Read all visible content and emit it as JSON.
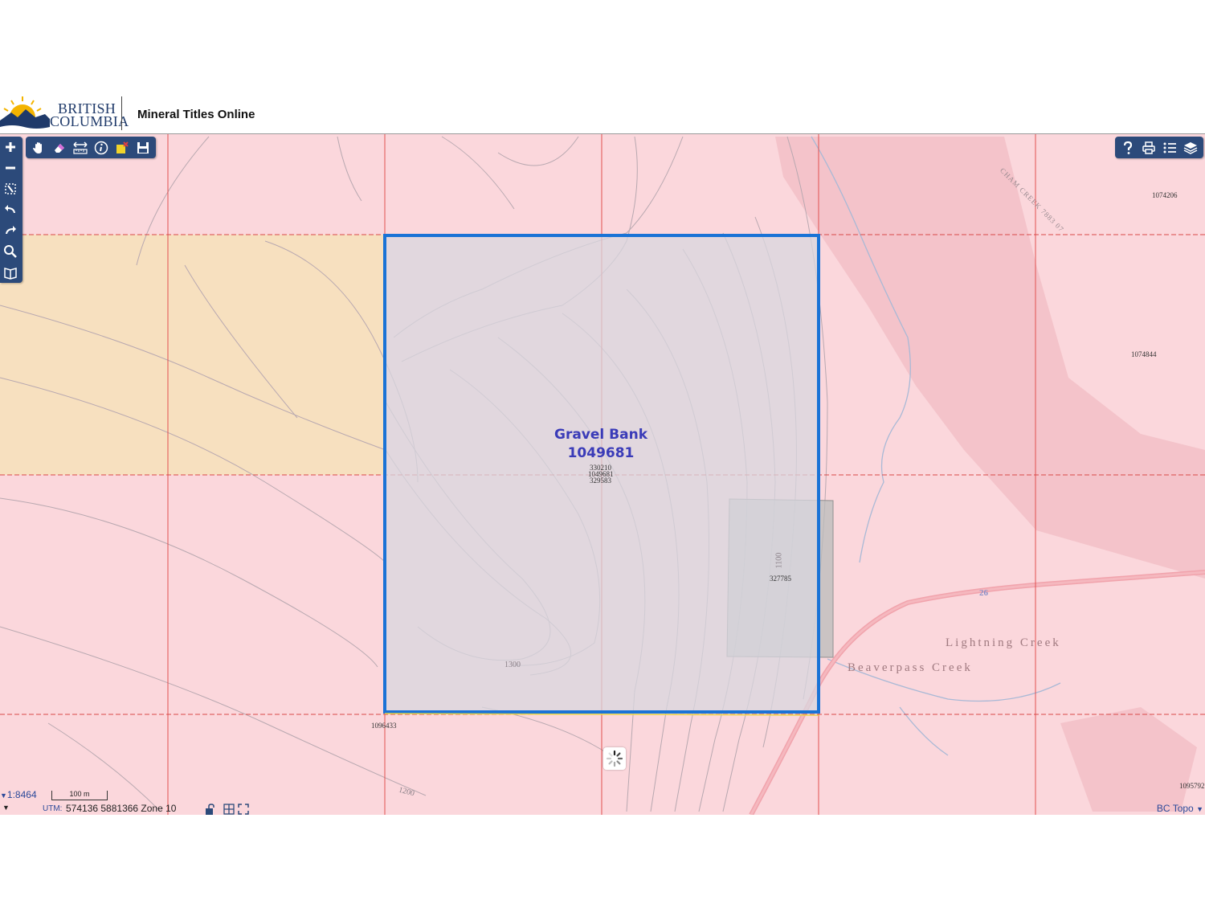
{
  "header": {
    "logo_line1": "BRITISH",
    "logo_line2": "COLUMBIA",
    "app_title": "Mineral Titles Online"
  },
  "toolbar_left_vertical": [
    "zoom-in-icon",
    "zoom-out-icon",
    "zoom-extent-icon",
    "back-icon",
    "forward-icon",
    "search-icon",
    "map-book-icon"
  ],
  "toolbar_top": [
    "pan-icon",
    "erase-icon",
    "measure-icon",
    "identify-icon",
    "clear-selection-icon",
    "save-icon"
  ],
  "toolbar_right": [
    "help-icon",
    "print-icon",
    "legend-icon",
    "layers-icon"
  ],
  "map": {
    "claim_name": "Gravel Bank",
    "claim_number": "1049681",
    "labels": {
      "cell_top": "330210",
      "cell_mid": "1049681",
      "cell_bottom": "329583",
      "small_claim": "327785",
      "bottom_left": "1096433",
      "right_top": "1074206",
      "right_mid": "1074844",
      "right_bottom": "1095792",
      "contour_1300": "1300",
      "contour_1200": "1200",
      "contour_1100": "1100",
      "highway": "26",
      "creek_top": "CHAM CREEK 7883 07",
      "lightning_creek": "Lightning Creek",
      "beaverpass_creek": "Beaverpass Creek"
    },
    "colors": {
      "tenure_pink": "#fbd7dc",
      "tenure_tan": "#f7e0bf",
      "selected_outline": "#1a73d6",
      "grid_red": "#e05050"
    }
  },
  "footer": {
    "scale_text": "1:8464",
    "scale_bar_label": "100 m",
    "coord_label": "UTM:",
    "coords": "574136 5881366 Zone 10",
    "basemap": "BC Topo"
  }
}
